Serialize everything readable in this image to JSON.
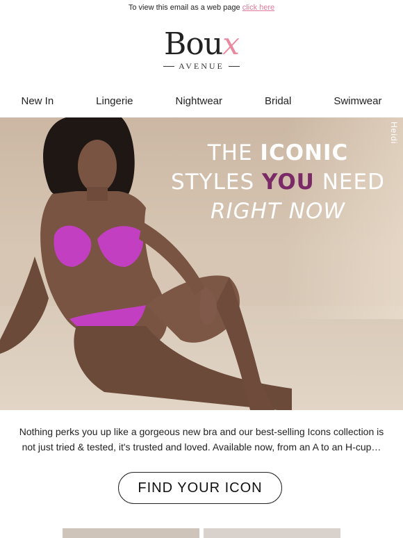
{
  "topbar": {
    "text": "To view this email as a web page",
    "link": "click here"
  },
  "logo": {
    "main": "Bou",
    "x": "x",
    "sub": "AVENUE"
  },
  "nav": [
    "New  In",
    "Lingerie",
    "Nightwear",
    "Bridal",
    "Swimwear"
  ],
  "hero": {
    "line1_pre": "THE ",
    "line1_bold": "ICONIC",
    "line2_pre": "STYLES ",
    "line2_bold": "YOU",
    "line2_post": " NEED",
    "line3": "RIGHT NOW",
    "tag": "Heidi"
  },
  "body": {
    "text": "Nothing perks you up like a gorgeous new bra and our best-selling Icons collection is not just tried & tested, it's trusted and loved. Available now, from an A to an H-cup…"
  },
  "cta": {
    "label": "FIND YOUR ICON"
  },
  "colors": {
    "accent_pink": "#e2799a",
    "headline_purple": "#7a2a66",
    "bra_magenta": "#c13fc0"
  }
}
